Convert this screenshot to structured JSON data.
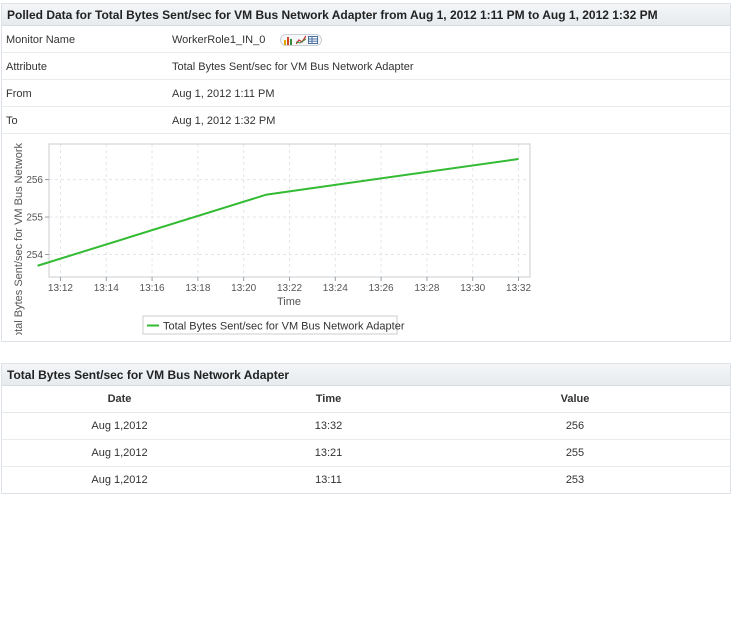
{
  "top_panel": {
    "title": "Polled Data for Total Bytes Sent/sec for VM Bus Network Adapter from Aug 1, 2012 1:11 PM to Aug 1, 2012 1:32 PM",
    "rows": [
      {
        "label": "Monitor Name",
        "value": "WorkerRole1_IN_0"
      },
      {
        "label": "Attribute",
        "value": "Total Bytes Sent/sec for VM Bus Network Adapter"
      },
      {
        "label": "From",
        "value": "Aug 1, 2012 1:11 PM"
      },
      {
        "label": "To",
        "value": "Aug 1, 2012 1:32 PM"
      }
    ],
    "monitor_icons": [
      "bar-chart-icon",
      "line-chart-icon",
      "table-icon"
    ]
  },
  "chart_data": {
    "type": "line",
    "xlabel": "Time",
    "ylabel": "Total Bytes Sent/sec for VM Bus Network",
    "x_ticks": [
      "13:12",
      "13:14",
      "13:16",
      "13:18",
      "13:20",
      "13:22",
      "13:24",
      "13:26",
      "13:28",
      "13:30",
      "13:32"
    ],
    "y_ticks": [
      "254",
      "255",
      "256"
    ],
    "x_range_minutes": [
      11.5,
      32.5
    ],
    "ylim": [
      253.4,
      256.95
    ],
    "grid": true,
    "legend_position": "bottom",
    "series": [
      {
        "name": "Total Bytes Sent/sec for VM Bus Network Adapter",
        "color": "#33bb33",
        "x_minutes": [
          11,
          21,
          32
        ],
        "y": [
          253.7,
          255.6,
          256.55
        ]
      }
    ]
  },
  "bottom_panel": {
    "title": "Total Bytes Sent/sec for VM Bus Network Adapter",
    "columns": [
      "Date",
      "Time",
      "Value"
    ],
    "rows": [
      [
        "Aug 1,2012",
        "13:32",
        "256"
      ],
      [
        "Aug 1,2012",
        "13:21",
        "255"
      ],
      [
        "Aug 1,2012",
        "13:11",
        "253"
      ]
    ]
  }
}
